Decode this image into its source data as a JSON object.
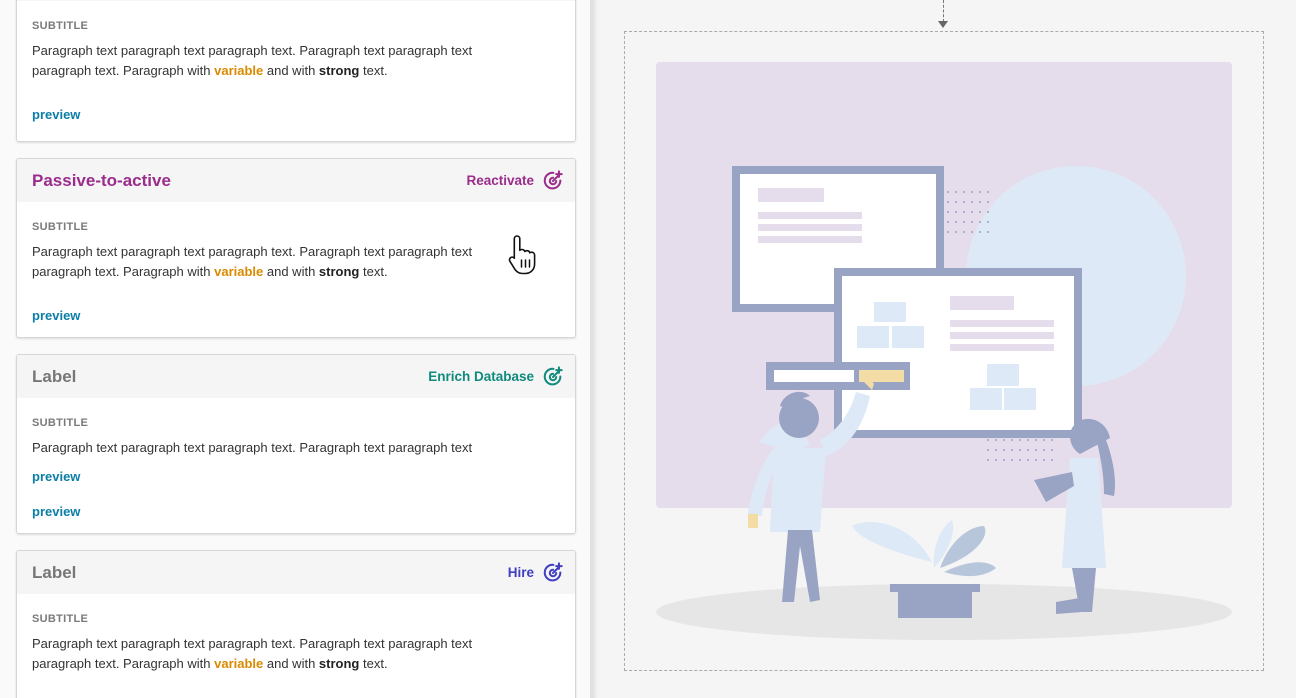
{
  "colors": {
    "purple": "#9b2c8c",
    "teal": "#0f8a7c",
    "indigo": "#3f3fc0",
    "link": "#0b7ea8",
    "variable": "#d98a00"
  },
  "cards": [
    {
      "subtitle": "SUBTITLE",
      "para_1": "Paragraph text paragraph text paragraph text.  Paragraph text paragraph text paragraph text. Paragraph with ",
      "var_word": "variable",
      "para_2": " and with ",
      "strong_word": "strong",
      "para_3": " text.",
      "preview": "preview"
    },
    {
      "title": "Passive-to-active",
      "action": "Reactivate",
      "action_icon": "target-plus-icon",
      "subtitle": "SUBTITLE",
      "para_1": "Paragraph text paragraph text paragraph text.  Paragraph text paragraph text paragraph text. Paragraph with ",
      "var_word": "variable",
      "para_2": " and with ",
      "strong_word": "strong",
      "para_3": " text.",
      "preview": "preview"
    },
    {
      "title": "Label",
      "action": "Enrich Database",
      "action_icon": "target-plus-icon",
      "subtitle": "SUBTITLE",
      "para": "Paragraph text paragraph text paragraph text.  Paragraph text paragraph text",
      "preview_1": "preview",
      "preview_2": "preview"
    },
    {
      "title": "Label",
      "action": "Hire",
      "action_icon": "target-plus-icon",
      "subtitle": "SUBTITLE",
      "para_1": "Paragraph text paragraph text paragraph text.  Paragraph text paragraph text paragraph text. Paragraph with ",
      "var_word": "variable",
      "para_2": " and with ",
      "strong_word": "strong",
      "para_3": " text."
    }
  ]
}
